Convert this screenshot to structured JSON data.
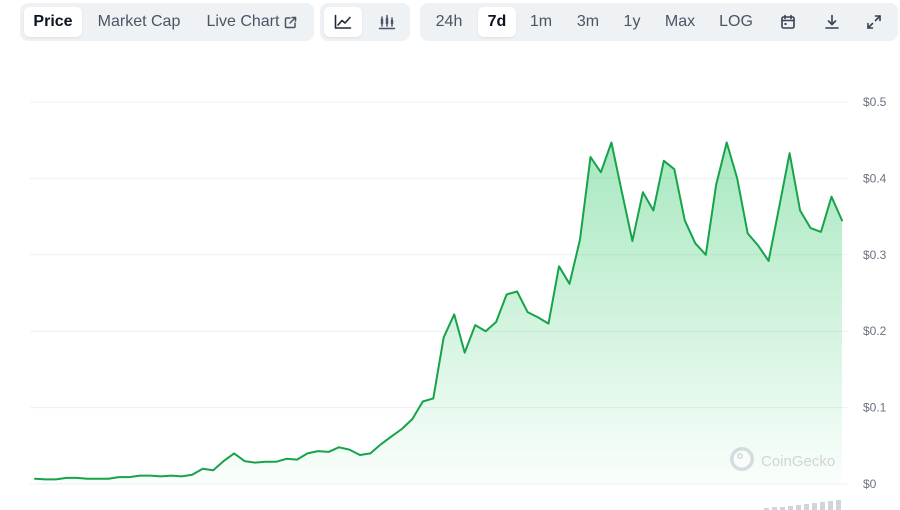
{
  "toolbar": {
    "view_tabs": [
      {
        "label": "Price",
        "active": true
      },
      {
        "label": "Market Cap",
        "active": false
      },
      {
        "label": "Live Chart",
        "active": false,
        "icon": "external-link-icon"
      }
    ],
    "chart_type_buttons": [
      {
        "icon": "line-chart-icon",
        "active": true
      },
      {
        "icon": "candlestick-chart-icon",
        "active": false
      }
    ],
    "ranges": [
      {
        "label": "24h",
        "active": false
      },
      {
        "label": "7d",
        "active": true
      },
      {
        "label": "1m",
        "active": false
      },
      {
        "label": "3m",
        "active": false
      },
      {
        "label": "1y",
        "active": false
      },
      {
        "label": "Max",
        "active": false
      },
      {
        "label": "LOG",
        "active": false
      }
    ],
    "tools": [
      {
        "icon": "calendar-icon"
      },
      {
        "icon": "download-icon"
      },
      {
        "icon": "expand-icon"
      }
    ]
  },
  "watermark": {
    "text": "CoinGecko",
    "icon": "coingecko-logo-icon"
  },
  "colors": {
    "line": "#16a34a",
    "fill": "#22c55e",
    "grid": "#eef0f3",
    "axis_text": "#6b7280"
  },
  "chart_data": {
    "type": "area",
    "title": "",
    "xlabel": "",
    "ylabel": "",
    "yticks": [
      "$0",
      "$0.1",
      "$0.2",
      "$0.3",
      "$0.4",
      "$0.5"
    ],
    "ylim": [
      0,
      0.5
    ],
    "grid": true,
    "y_axis_position": "right",
    "series": [
      {
        "values": [
          0.007,
          0.006,
          0.006,
          0.008,
          0.008,
          0.007,
          0.007,
          0.007,
          0.009,
          0.009,
          0.011,
          0.011,
          0.01,
          0.011,
          0.01,
          0.012,
          0.02,
          0.018,
          0.03,
          0.04,
          0.03,
          0.028,
          0.029,
          0.029,
          0.033,
          0.032,
          0.04,
          0.043,
          0.042,
          0.048,
          0.045,
          0.038,
          0.04,
          0.052,
          0.062,
          0.072,
          0.085,
          0.108,
          0.112,
          0.192,
          0.222,
          0.172,
          0.208,
          0.2,
          0.212,
          0.248,
          0.252,
          0.225,
          0.218,
          0.21,
          0.285,
          0.262,
          0.32,
          0.428,
          0.408,
          0.447,
          0.382,
          0.318,
          0.382,
          0.358,
          0.423,
          0.412,
          0.345,
          0.315,
          0.3,
          0.392,
          0.447,
          0.4,
          0.328,
          0.312,
          0.292,
          0.362,
          0.433,
          0.358,
          0.335,
          0.33,
          0.376,
          0.345
        ]
      }
    ]
  }
}
